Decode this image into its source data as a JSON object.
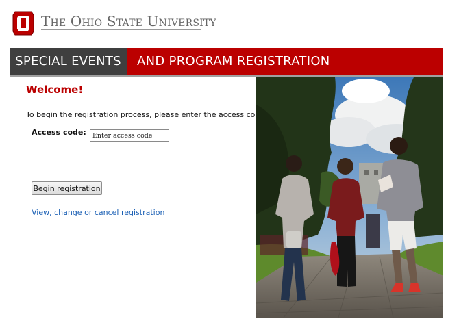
{
  "header": {
    "university_name": "The Ohio State University",
    "logo_letter": "O",
    "brand_color": "#bb0000"
  },
  "banner": {
    "left_text": "SPECIAL EVENTS",
    "right_text": "AND PROGRAM REGISTRATION",
    "left_color": "#3f3f3f",
    "right_color": "#bb0000"
  },
  "main": {
    "welcome": "Welcome!",
    "instructions": "To begin the registration process, please enter the access code.",
    "access_code_label": "Access code:",
    "access_code_placeholder": "Enter access code",
    "access_code_value": "",
    "begin_button": "Begin registration",
    "manage_link": "View, change or cancel registration"
  },
  "photo": {
    "description_icon": "campus-photo"
  }
}
